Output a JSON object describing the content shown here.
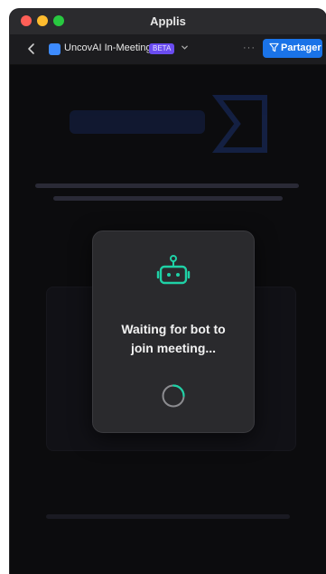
{
  "window": {
    "title": "Applis"
  },
  "toolbar": {
    "back_icon": "chevron-left-icon",
    "app_icon": "app-icon",
    "app_name": "UncovAI In-Meeting",
    "badge": "BETA",
    "dropdown_icon": "chevron-down-icon",
    "more_label": "···",
    "share_label": "Partager",
    "share_icon": "filter-icon"
  },
  "modal": {
    "icon": "robot-icon",
    "message_line1": "Waiting for bot to",
    "message_line2": "join meeting...",
    "spinner_icon": "spinner-icon"
  },
  "colors": {
    "accent": "#1a73e8",
    "bot_icon": "#1fd1a6",
    "badge": "#6a4cf0"
  }
}
